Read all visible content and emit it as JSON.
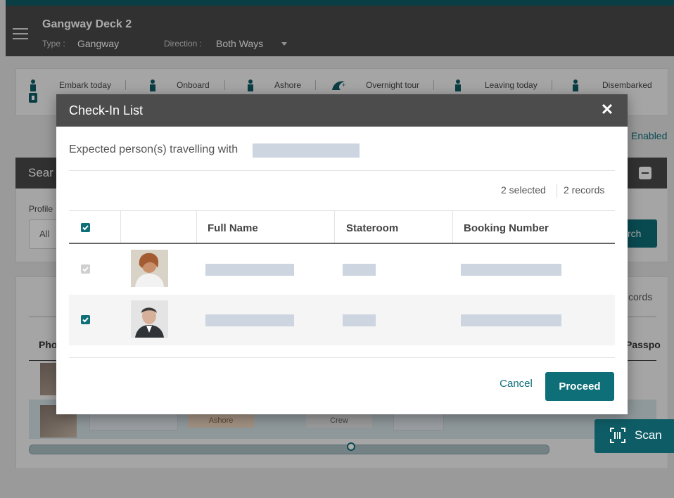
{
  "header": {
    "title": "Gangway Deck 2",
    "type_label": "Type :",
    "type_value": "Gangway",
    "direction_label": "Direction :",
    "direction_value": "Both Ways"
  },
  "stats": {
    "items": [
      {
        "label": "Embark today",
        "icon": "person-luggage-icon"
      },
      {
        "label": "Onboard",
        "icon": "person-icon"
      },
      {
        "label": "Ashore",
        "icon": "person-icon"
      },
      {
        "label": "Overnight tour",
        "icon": "moon-stars-icon"
      },
      {
        "label": "Leaving today",
        "icon": "person-icon"
      },
      {
        "label": "Disembarked",
        "icon": "person-icon"
      }
    ]
  },
  "background": {
    "enabled_text": "Enabled",
    "search_title": "Sear",
    "profile_label": "Profile",
    "profile_value": "All",
    "search_button": "rch",
    "records_text": "cords",
    "photo_header": "Pho",
    "passport_header": "Passpo",
    "tags": [
      "Ashore",
      "Crew"
    ],
    "scan_label": "Scan"
  },
  "modal": {
    "title": "Check-In List",
    "close_icon": "close-icon",
    "subtitle": "Expected person(s) travelling with",
    "selected_count": "2 selected",
    "records_count": "2 records",
    "columns": [
      "Full Name",
      "Stateroom",
      "Booking Number"
    ],
    "rows": [
      {
        "checked": true,
        "disabled": true,
        "full_name": "",
        "stateroom": "",
        "booking_number": ""
      },
      {
        "checked": true,
        "disabled": false,
        "full_name": "",
        "stateroom": "",
        "booking_number": ""
      }
    ],
    "cancel_label": "Cancel",
    "proceed_label": "Proceed"
  },
  "colors": {
    "accent": "#0e6f79",
    "header_bg": "#4a4a4a",
    "redaction": "#ccd5e0"
  }
}
